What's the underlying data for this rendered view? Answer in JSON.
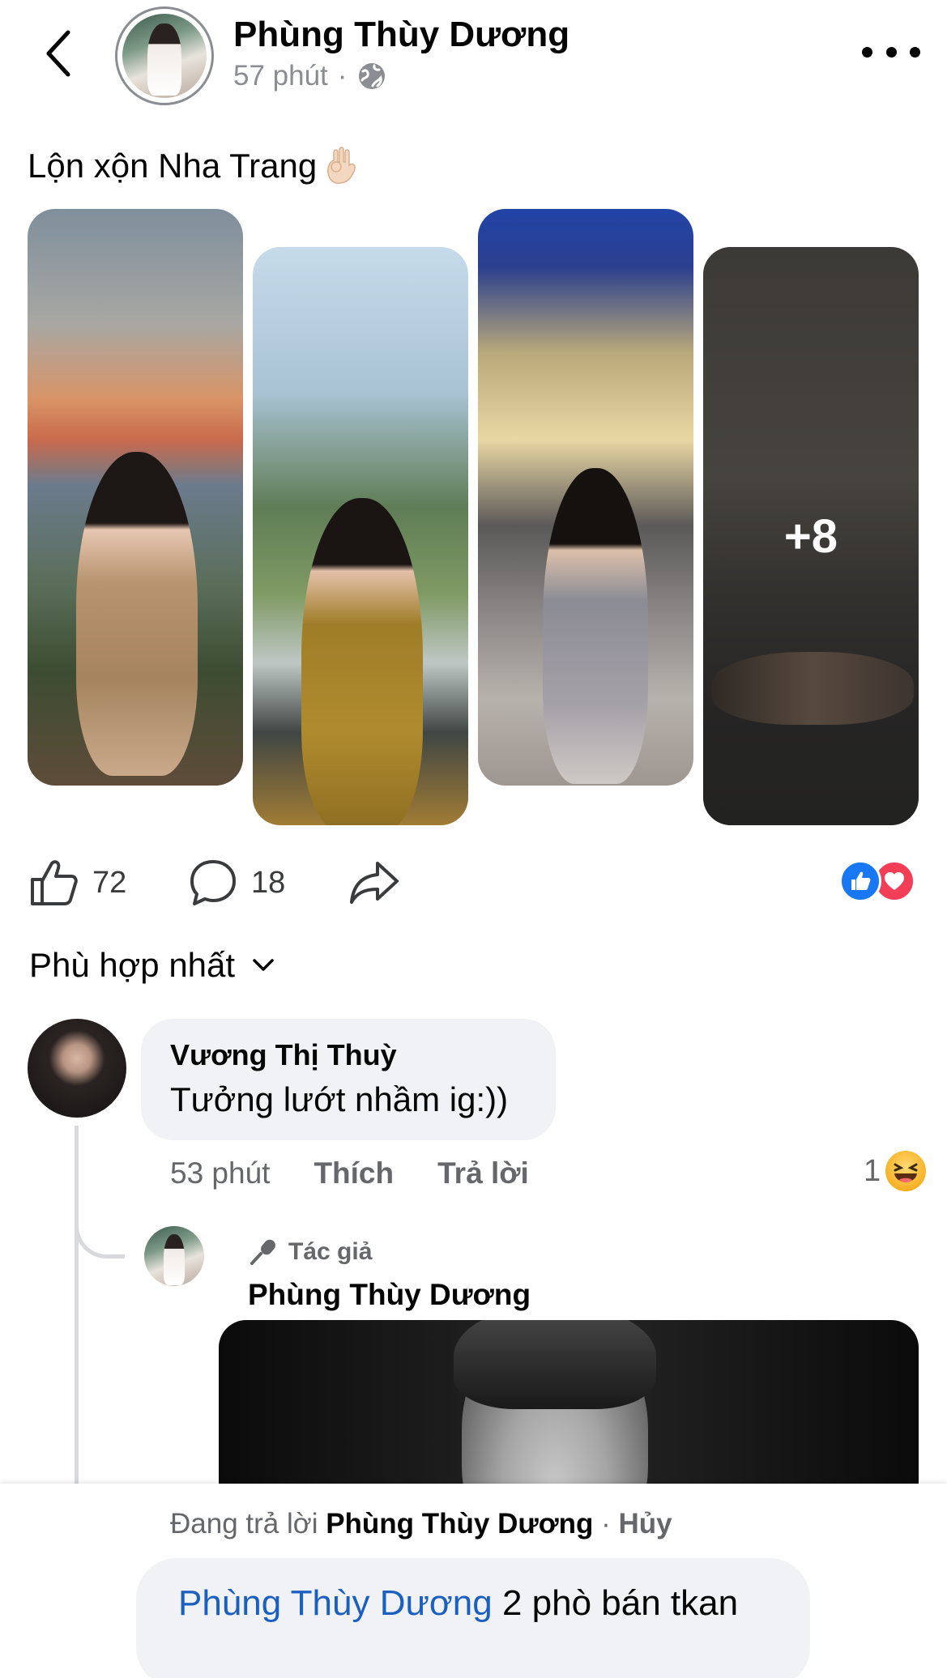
{
  "post": {
    "author": "Phùng Thùy Dương",
    "time": "57 phút",
    "separator": "·",
    "privacy_icon": "globe-icon",
    "text": "Lộn xộn Nha Trang",
    "emoji": "hand-gesture-emoji",
    "extra_photos": "+8"
  },
  "actions": {
    "like_count": "72",
    "comment_count": "18",
    "reactions": [
      "like",
      "love"
    ],
    "colors": {
      "like": "#1877f2",
      "love": "#f33e58"
    }
  },
  "sort": {
    "label": "Phù hợp nhất"
  },
  "comment": {
    "author": "Vương Thị Thuỳ",
    "text": "Tưởng lướt nhầm ig:))",
    "time": "53 phút",
    "like_label": "Thích",
    "reply_label": "Trả lời",
    "reaction_count": "1",
    "reaction": "haha"
  },
  "reply": {
    "badge": "Tác giả",
    "author": "Phùng Thùy Dương"
  },
  "composer": {
    "replying_prefix": "Đang trả lời",
    "replying_to": "Phùng Thùy Dương",
    "separator": "·",
    "cancel": "Hủy",
    "mention": "Phùng Thùy Dương",
    "text": " 2 phò bán tkan",
    "mention_color": "#1b5fc1"
  }
}
